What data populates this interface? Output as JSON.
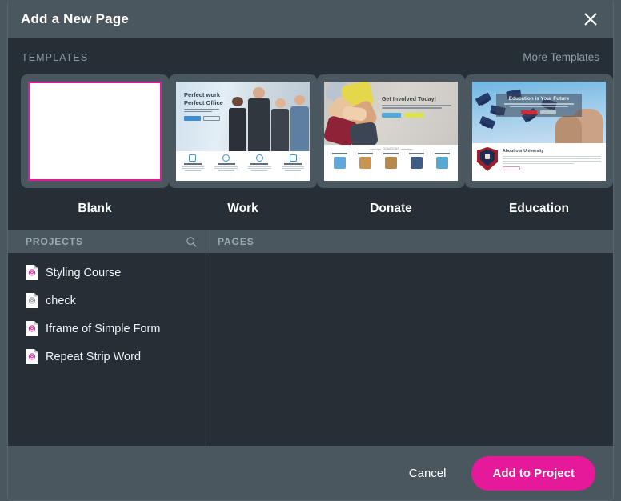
{
  "dialog": {
    "title": "Add a New Page",
    "close_icon": "close-x-icon"
  },
  "templates": {
    "section_label": "TEMPLATES",
    "more_link": "More Templates",
    "selected_index": 0,
    "accent_color": "#e6199a",
    "items": [
      {
        "label": "Blank",
        "selected": true,
        "preview": {
          "kind": "blank"
        }
      },
      {
        "label": "Work",
        "selected": false,
        "preview": {
          "kind": "work",
          "headline_line1": "Perfect work",
          "headline_line2": "Perfect Office",
          "feature_count": 4
        }
      },
      {
        "label": "Donate",
        "selected": false,
        "preview": {
          "kind": "donate",
          "headline": "Get Involved Today!",
          "divider_text": "DONATIONS",
          "category_count": 5
        }
      },
      {
        "label": "Education",
        "selected": false,
        "preview": {
          "kind": "education",
          "headline": "Education is Your Future",
          "subheading": "About our University"
        }
      }
    ]
  },
  "panels": {
    "projects": {
      "header": "PROJECTS",
      "search_icon": "search-icon",
      "items": [
        {
          "name": "Styling Course",
          "icon": "document-icon",
          "icon_color": "#e6199a"
        },
        {
          "name": "check",
          "icon": "document-icon",
          "icon_color": "#8b969d"
        },
        {
          "name": "Iframe of Simple Form",
          "icon": "document-icon",
          "icon_color": "#e6199a"
        },
        {
          "name": "Repeat Strip Word",
          "icon": "document-icon",
          "icon_color": "#e6199a"
        }
      ]
    },
    "pages": {
      "header": "PAGES",
      "items": []
    }
  },
  "footer": {
    "cancel_label": "Cancel",
    "submit_label": "Add to Project"
  }
}
